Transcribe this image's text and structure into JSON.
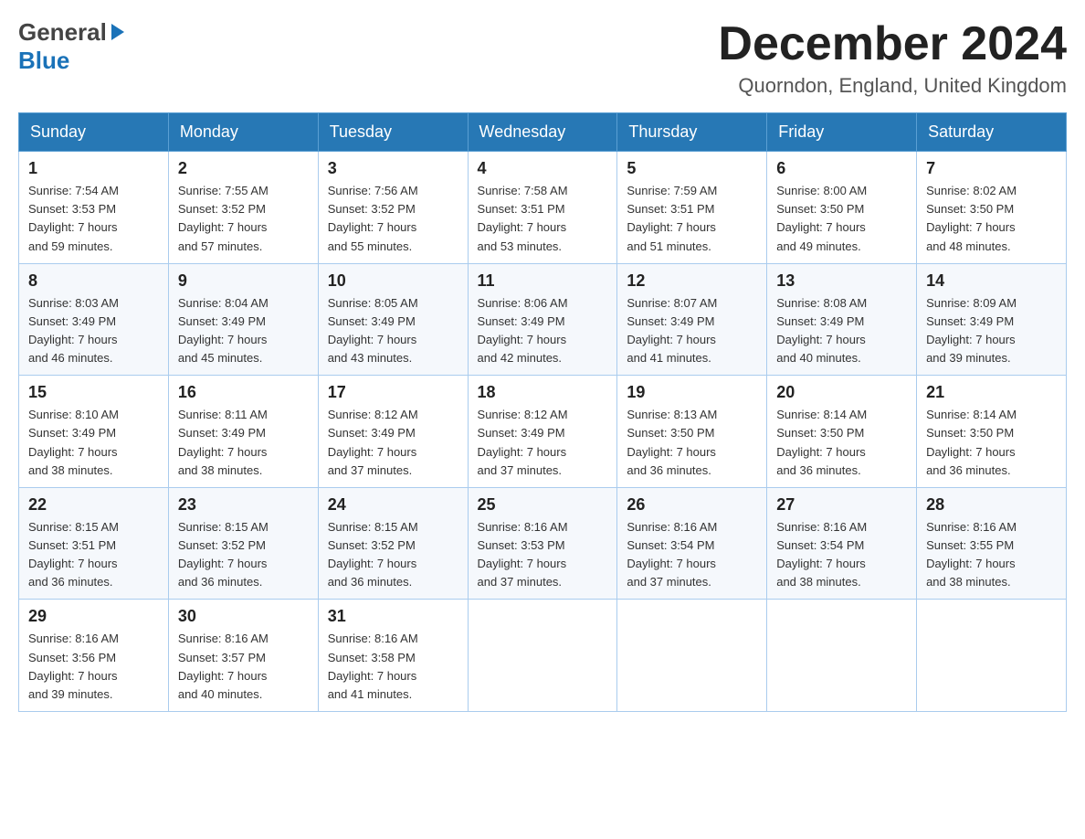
{
  "header": {
    "logo": {
      "general": "General",
      "blue": "Blue",
      "arrow_unicode": "▶"
    },
    "title": "December 2024",
    "location": "Quorndon, England, United Kingdom"
  },
  "calendar": {
    "days_of_week": [
      "Sunday",
      "Monday",
      "Tuesday",
      "Wednesday",
      "Thursday",
      "Friday",
      "Saturday"
    ],
    "weeks": [
      [
        {
          "day": "1",
          "info": "Sunrise: 7:54 AM\nSunset: 3:53 PM\nDaylight: 7 hours\nand 59 minutes."
        },
        {
          "day": "2",
          "info": "Sunrise: 7:55 AM\nSunset: 3:52 PM\nDaylight: 7 hours\nand 57 minutes."
        },
        {
          "day": "3",
          "info": "Sunrise: 7:56 AM\nSunset: 3:52 PM\nDaylight: 7 hours\nand 55 minutes."
        },
        {
          "day": "4",
          "info": "Sunrise: 7:58 AM\nSunset: 3:51 PM\nDaylight: 7 hours\nand 53 minutes."
        },
        {
          "day": "5",
          "info": "Sunrise: 7:59 AM\nSunset: 3:51 PM\nDaylight: 7 hours\nand 51 minutes."
        },
        {
          "day": "6",
          "info": "Sunrise: 8:00 AM\nSunset: 3:50 PM\nDaylight: 7 hours\nand 49 minutes."
        },
        {
          "day": "7",
          "info": "Sunrise: 8:02 AM\nSunset: 3:50 PM\nDaylight: 7 hours\nand 48 minutes."
        }
      ],
      [
        {
          "day": "8",
          "info": "Sunrise: 8:03 AM\nSunset: 3:49 PM\nDaylight: 7 hours\nand 46 minutes."
        },
        {
          "day": "9",
          "info": "Sunrise: 8:04 AM\nSunset: 3:49 PM\nDaylight: 7 hours\nand 45 minutes."
        },
        {
          "day": "10",
          "info": "Sunrise: 8:05 AM\nSunset: 3:49 PM\nDaylight: 7 hours\nand 43 minutes."
        },
        {
          "day": "11",
          "info": "Sunrise: 8:06 AM\nSunset: 3:49 PM\nDaylight: 7 hours\nand 42 minutes."
        },
        {
          "day": "12",
          "info": "Sunrise: 8:07 AM\nSunset: 3:49 PM\nDaylight: 7 hours\nand 41 minutes."
        },
        {
          "day": "13",
          "info": "Sunrise: 8:08 AM\nSunset: 3:49 PM\nDaylight: 7 hours\nand 40 minutes."
        },
        {
          "day": "14",
          "info": "Sunrise: 8:09 AM\nSunset: 3:49 PM\nDaylight: 7 hours\nand 39 minutes."
        }
      ],
      [
        {
          "day": "15",
          "info": "Sunrise: 8:10 AM\nSunset: 3:49 PM\nDaylight: 7 hours\nand 38 minutes."
        },
        {
          "day": "16",
          "info": "Sunrise: 8:11 AM\nSunset: 3:49 PM\nDaylight: 7 hours\nand 38 minutes."
        },
        {
          "day": "17",
          "info": "Sunrise: 8:12 AM\nSunset: 3:49 PM\nDaylight: 7 hours\nand 37 minutes."
        },
        {
          "day": "18",
          "info": "Sunrise: 8:12 AM\nSunset: 3:49 PM\nDaylight: 7 hours\nand 37 minutes."
        },
        {
          "day": "19",
          "info": "Sunrise: 8:13 AM\nSunset: 3:50 PM\nDaylight: 7 hours\nand 36 minutes."
        },
        {
          "day": "20",
          "info": "Sunrise: 8:14 AM\nSunset: 3:50 PM\nDaylight: 7 hours\nand 36 minutes."
        },
        {
          "day": "21",
          "info": "Sunrise: 8:14 AM\nSunset: 3:50 PM\nDaylight: 7 hours\nand 36 minutes."
        }
      ],
      [
        {
          "day": "22",
          "info": "Sunrise: 8:15 AM\nSunset: 3:51 PM\nDaylight: 7 hours\nand 36 minutes."
        },
        {
          "day": "23",
          "info": "Sunrise: 8:15 AM\nSunset: 3:52 PM\nDaylight: 7 hours\nand 36 minutes."
        },
        {
          "day": "24",
          "info": "Sunrise: 8:15 AM\nSunset: 3:52 PM\nDaylight: 7 hours\nand 36 minutes."
        },
        {
          "day": "25",
          "info": "Sunrise: 8:16 AM\nSunset: 3:53 PM\nDaylight: 7 hours\nand 37 minutes."
        },
        {
          "day": "26",
          "info": "Sunrise: 8:16 AM\nSunset: 3:54 PM\nDaylight: 7 hours\nand 37 minutes."
        },
        {
          "day": "27",
          "info": "Sunrise: 8:16 AM\nSunset: 3:54 PM\nDaylight: 7 hours\nand 38 minutes."
        },
        {
          "day": "28",
          "info": "Sunrise: 8:16 AM\nSunset: 3:55 PM\nDaylight: 7 hours\nand 38 minutes."
        }
      ],
      [
        {
          "day": "29",
          "info": "Sunrise: 8:16 AM\nSunset: 3:56 PM\nDaylight: 7 hours\nand 39 minutes."
        },
        {
          "day": "30",
          "info": "Sunrise: 8:16 AM\nSunset: 3:57 PM\nDaylight: 7 hours\nand 40 minutes."
        },
        {
          "day": "31",
          "info": "Sunrise: 8:16 AM\nSunset: 3:58 PM\nDaylight: 7 hours\nand 41 minutes."
        },
        {
          "day": "",
          "info": ""
        },
        {
          "day": "",
          "info": ""
        },
        {
          "day": "",
          "info": ""
        },
        {
          "day": "",
          "info": ""
        }
      ]
    ]
  }
}
